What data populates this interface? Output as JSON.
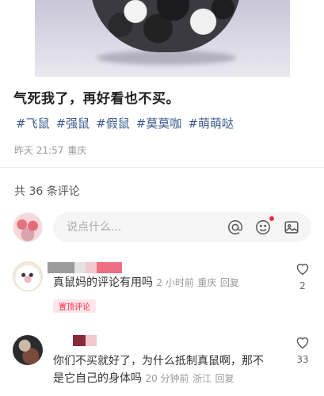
{
  "post": {
    "title": "气死我了，再好看也不买。",
    "tags": [
      "#飞鼠",
      "#强鼠",
      "#假鼠",
      "#莫莫咖",
      "#萌萌哒"
    ],
    "date": "昨天 21:57",
    "location": "重庆"
  },
  "comments_header": {
    "count_label": "共 36 条评论"
  },
  "input": {
    "placeholder": "说点什么..."
  },
  "icons": {
    "at": "at-icon",
    "emoji": "emoji-icon",
    "image": "image-icon",
    "like": "heart-icon"
  },
  "colors": {
    "accent": "#ff2442",
    "tag": "#3a5b8c"
  },
  "comments": [
    {
      "text": "真鼠妈的评论有用吗",
      "time": "2 小时前",
      "location": "重庆",
      "reply": "回复",
      "badge": "置顶评论",
      "likes": "2"
    },
    {
      "line1": "你们不买就好了，为什么抵制真鼠啊，那不",
      "line2": "是它自己的身体吗",
      "time": "20 分钟前",
      "location": "浙江",
      "reply": "回复",
      "likes": "33"
    }
  ]
}
